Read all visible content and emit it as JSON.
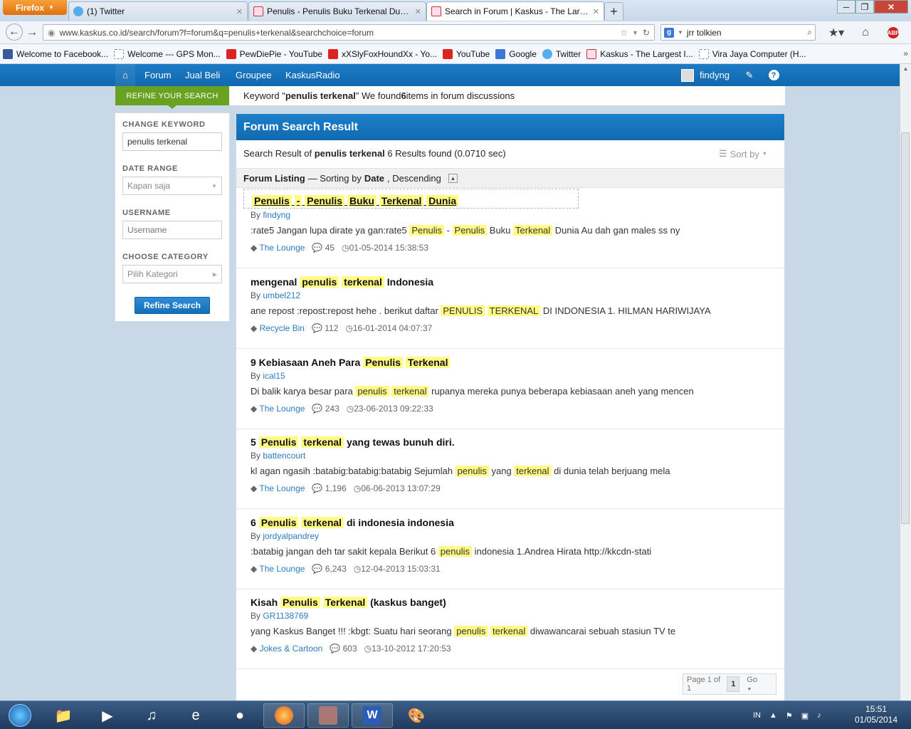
{
  "browser": {
    "menu_label": "Firefox",
    "tabs": [
      {
        "label": "(1) Twitter",
        "icon": "twitter-icon"
      },
      {
        "label": "Penulis - Penulis Buku Terkenal Duni...",
        "icon": "kaskus-icon"
      },
      {
        "label": "Search in Forum | Kaskus - The Large...",
        "icon": "kaskus-icon"
      }
    ],
    "url": "www.kaskus.co.id/search/forum?f=forum&q=penulis+terkenal&searchchoice=forum",
    "search_value": "jrr tolkien",
    "bookmarks": [
      {
        "label": "Welcome to Facebook...",
        "icon": "facebook-icon"
      },
      {
        "label": "Welcome --- GPS Mon...",
        "icon": "page-icon"
      },
      {
        "label": "PewDiePie - YouTube",
        "icon": "youtube-icon"
      },
      {
        "label": "xXSlyFoxHoundXx - Yo...",
        "icon": "youtube-icon"
      },
      {
        "label": "YouTube",
        "icon": "youtube-icon"
      },
      {
        "label": "Google",
        "icon": "google-icon"
      },
      {
        "label": "Twitter",
        "icon": "twitter-icon"
      },
      {
        "label": "Kaskus - The Largest I...",
        "icon": "kaskus-icon"
      },
      {
        "label": "Vira Jaya Computer (H...",
        "icon": "page-icon"
      }
    ]
  },
  "kaskus_nav": {
    "items": [
      "Forum",
      "Jual Beli",
      "Groupee",
      "KaskusRadio"
    ],
    "username": "findyng"
  },
  "sidebar": {
    "refine_label": "REFINE YOUR SEARCH",
    "change_keyword_label": "CHANGE KEYWORD",
    "keyword_value": "penulis terkenal",
    "date_range_label": "DATE RANGE",
    "date_range_value": "Kapan saja",
    "username_label": "USERNAME",
    "username_placeholder": "Username",
    "category_label": "CHOOSE CATEGORY",
    "category_value": "Pilih Kategori",
    "refine_button": "Refine Search"
  },
  "keyword_strip": {
    "prefix": "Keyword \"",
    "keyword": "penulis terkenal",
    "middle": "\" We found ",
    "count": "6",
    "suffix": " items in forum discussions"
  },
  "results": {
    "header": "Forum Search Result",
    "summary_prefix": "Search Result of ",
    "summary_keyword": "penulis terkenal",
    "summary_suffix": " 6 Results found (0.0710 sec)",
    "sort_label": "Sort by",
    "listing_title": "Forum Listing",
    "listing_sort_prefix": " — Sorting by ",
    "listing_sort_field": "Date",
    "listing_sort_order": ", Descending",
    "items": [
      {
        "title": [
          [
            "Penulis",
            true
          ],
          [
            " ",
            false
          ],
          [
            "-",
            true
          ],
          [
            " ",
            false
          ],
          [
            "Penulis",
            true
          ],
          [
            " ",
            false
          ],
          [
            "Buku",
            true
          ],
          [
            " ",
            false
          ],
          [
            "Terkenal",
            true
          ],
          [
            " ",
            false
          ],
          [
            "Dunia",
            true
          ]
        ],
        "by": "By ",
        "author": "findyng",
        "excerpt": [
          [
            ":rate5 Jangan lupa dirate ya gan:rate5 ",
            false
          ],
          [
            "Penulis",
            true
          ],
          [
            " - ",
            false
          ],
          [
            "Penulis",
            true
          ],
          [
            " Buku ",
            false
          ],
          [
            "Terkenal",
            true
          ],
          [
            " Dunia Au dah gan males ss ny",
            false
          ]
        ],
        "category": "The Lounge",
        "replies": "45",
        "date": "01-05-2014 15:38:53"
      },
      {
        "title": [
          [
            "mengenal ",
            false
          ],
          [
            "penulis",
            true
          ],
          [
            " ",
            false
          ],
          [
            "terkenal",
            true
          ],
          [
            " Indonesia",
            false
          ]
        ],
        "by": "By ",
        "author": "umbel212",
        "excerpt": [
          [
            "ane repost :repost:repost hehe . berikut daftar ",
            false
          ],
          [
            "PENULIS",
            true
          ],
          [
            " ",
            false
          ],
          [
            "TERKENAL",
            true
          ],
          [
            " DI INDONESIA 1. HILMAN HARIWIJAYA",
            false
          ]
        ],
        "category": "Recycle Bin",
        "replies": "112",
        "date": "16-01-2014 04:07:37"
      },
      {
        "title": [
          [
            "9 Kebiasaan Aneh Para ",
            false
          ],
          [
            "Penulis",
            true
          ],
          [
            " ",
            false
          ],
          [
            "Terkenal",
            true
          ]
        ],
        "by": "By ",
        "author": "ical15",
        "excerpt": [
          [
            "Di balik karya besar para ",
            false
          ],
          [
            "penulis",
            true
          ],
          [
            " ",
            false
          ],
          [
            "terkenal",
            true
          ],
          [
            " rupanya mereka punya beberapa kebiasaan aneh yang mencen",
            false
          ]
        ],
        "category": "The Lounge",
        "replies": "243",
        "date": "23-06-2013 09:22:33"
      },
      {
        "title": [
          [
            "5 ",
            false
          ],
          [
            "Penulis",
            true
          ],
          [
            " ",
            false
          ],
          [
            "terkenal",
            true
          ],
          [
            " yang tewas bunuh diri.",
            false
          ]
        ],
        "by": "By ",
        "author": "battencourt",
        "excerpt": [
          [
            "kl agan ngasih :batabig:batabig:batabig Sejumlah ",
            false
          ],
          [
            "penulis",
            true
          ],
          [
            " yang ",
            false
          ],
          [
            "terkenal",
            true
          ],
          [
            " di dunia telah berjuang mela",
            false
          ]
        ],
        "category": "The Lounge",
        "replies": "1,196",
        "date": "06-06-2013 13:07:29"
      },
      {
        "title": [
          [
            "6 ",
            false
          ],
          [
            "Penulis",
            true
          ],
          [
            " ",
            false
          ],
          [
            "terkenal",
            true
          ],
          [
            " di indonesia indonesia",
            false
          ]
        ],
        "by": "By ",
        "author": "jordyalpandrey",
        "excerpt": [
          [
            ":batabig jangan deh tar sakit kepala Berikut 6 ",
            false
          ],
          [
            "penulis",
            true
          ],
          [
            " indonesia 1.Andrea Hirata http://kkcdn-stati",
            false
          ]
        ],
        "category": "The Lounge",
        "replies": "6,243",
        "date": "12-04-2013 15:03:31"
      },
      {
        "title": [
          [
            "Kisah ",
            false
          ],
          [
            "Penulis",
            true
          ],
          [
            " ",
            false
          ],
          [
            "Terkenal",
            true
          ],
          [
            " (kaskus banget)",
            false
          ]
        ],
        "by": "By ",
        "author": "GR1138769",
        "excerpt": [
          [
            "yang Kaskus Banget !!! :kbgt: Suatu hari seorang ",
            false
          ],
          [
            "penulis",
            true
          ],
          [
            " ",
            false
          ],
          [
            "terkenal",
            true
          ],
          [
            " diwawancarai sebuah stasiun TV te",
            false
          ]
        ],
        "category": "Jokes & Cartoon",
        "replies": "603",
        "date": "13-10-2012 17:20:53"
      }
    ],
    "pager": {
      "page_label": "Page 1 of 1",
      "current": "1",
      "go": "Go"
    }
  },
  "taskbar": {
    "language": "IN",
    "time": "15:51",
    "date": "01/05/2014"
  },
  "colors": {
    "kaskus_blue": "#1168ad",
    "refine_green": "#69a120",
    "highlight": "#fffb85",
    "link": "#2a7bc0"
  }
}
